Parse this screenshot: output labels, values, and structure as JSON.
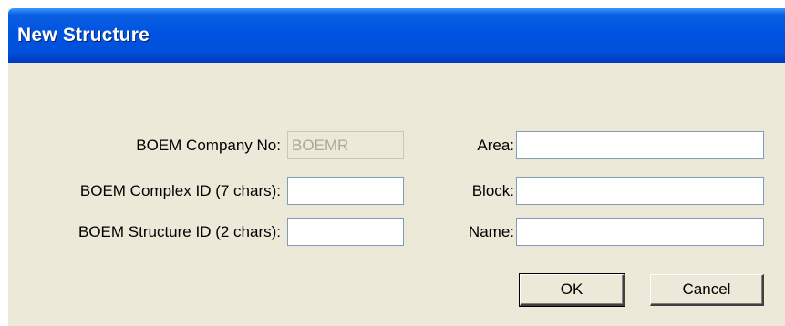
{
  "window": {
    "title": "New Structure"
  },
  "form": {
    "company_no": {
      "label": "BOEM Company No:",
      "value": "BOEMR"
    },
    "complex_id": {
      "label": "BOEM Complex ID (7 chars):",
      "value": ""
    },
    "structure_id": {
      "label": "BOEM Structure ID (2 chars):",
      "value": ""
    },
    "area": {
      "label": "Area:",
      "value": ""
    },
    "block": {
      "label": "Block:",
      "value": ""
    },
    "name": {
      "label": "Name:",
      "value": ""
    }
  },
  "buttons": {
    "ok_label": "OK",
    "cancel_label": "Cancel"
  },
  "colors": {
    "titlebar": "#0054e3",
    "dialog_background": "#ece9d8",
    "field_border": "#7f9db9"
  }
}
